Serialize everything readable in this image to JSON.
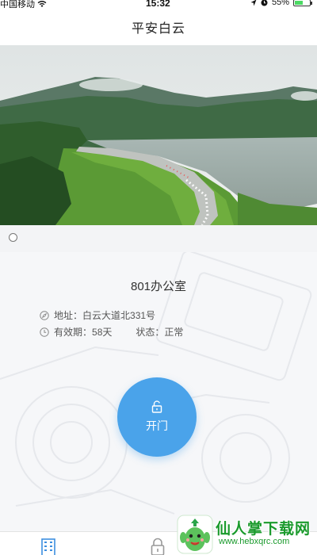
{
  "status_bar": {
    "carrier": "中国移动",
    "time": "15:32",
    "battery_percent": "55%",
    "battery_level": 0.55
  },
  "nav": {
    "title": "平安白云"
  },
  "banner": {
    "image": "mountain-lake-marathon-photo",
    "page_index": 1
  },
  "room": {
    "name": "801办公室",
    "address_label": "地址：",
    "address_value": "白云大道北331号",
    "validity_label": "有效期：",
    "validity_value": "58天",
    "status_label": "状态：",
    "status_value": "正常"
  },
  "open_button": {
    "label": "开门",
    "color": "#4aa3ea"
  },
  "tabs": [
    {
      "icon": "building-icon",
      "active": true,
      "color": "#3d8fe0"
    },
    {
      "icon": "lock-icon",
      "active": false,
      "color": "#999999"
    }
  ],
  "watermark": {
    "title": "仙人掌下载网",
    "url": "www.hebxqrc.com"
  }
}
